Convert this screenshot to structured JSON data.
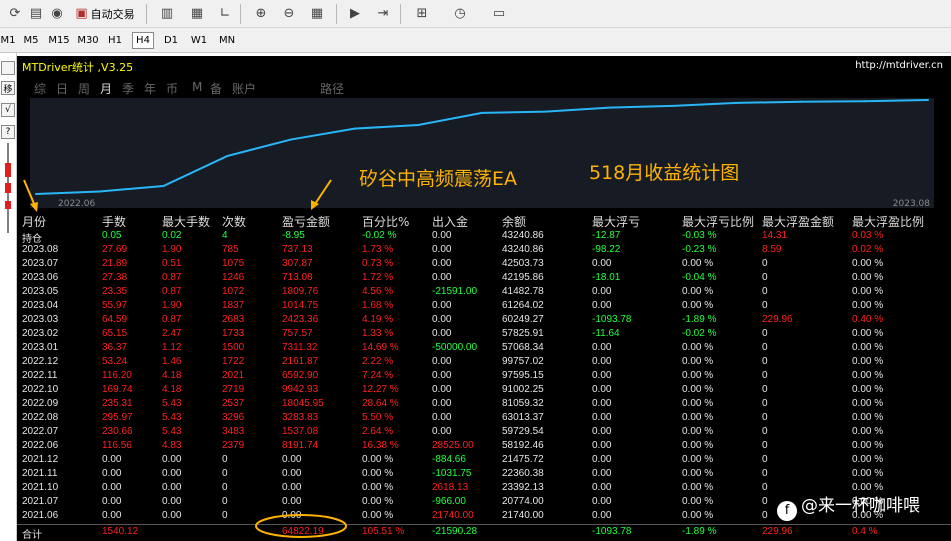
{
  "toolbar": {
    "auto_trade_label": "自动交易",
    "icons": [
      "refresh-icon",
      "chart-icon",
      "signal-icon",
      "auto-trade-icon",
      "bar-chart-icon",
      "candlestick-icon",
      "line-chart-icon",
      "zoom-in-icon",
      "zoom-out-icon",
      "tile-windows-icon",
      "chart-shift-icon",
      "autoscroll-icon",
      "indicators-icon",
      "periods-icon",
      "templates-icon"
    ]
  },
  "timeframes": [
    "M1",
    "M5",
    "M15",
    "M30",
    "H1",
    "H4",
    "D1",
    "W1",
    "MN"
  ],
  "timeframe_selected": "H4",
  "left_strip": [
    "移",
    "√",
    "?"
  ],
  "panel": {
    "title": "MTDriver统计 ,V3.25",
    "url": "http://mtdriver.cn",
    "tabs": [
      "综",
      "日",
      "周",
      "月",
      "季",
      "年",
      "币",
      "M",
      "备",
      "账户",
      "路径"
    ],
    "selected_tab": "月",
    "chart_start": "2022.06",
    "chart_end": "2023.08",
    "annotation_left": "矽谷中高频震荡EA",
    "annotation_right": "518月收益统计图"
  },
  "chart_data": {
    "type": "line",
    "x": [
      "2022.06",
      "2022.07",
      "2022.08",
      "2022.09",
      "2022.10",
      "2022.11",
      "2022.12",
      "2023.01",
      "2023.02",
      "2023.03",
      "2023.04",
      "2023.05",
      "2023.06",
      "2023.07",
      "2023.08"
    ],
    "values": [
      8191.74,
      9728.8,
      13012.63,
      31058.58,
      41001.51,
      47594.41,
      49756.28,
      57067.6,
      57825.17,
      60248.53,
      61263.28,
      63073.04,
      63786.12,
      64093.99,
      64831.12
    ],
    "color": "#29b6f6",
    "grid": false
  },
  "table": {
    "headers": [
      "月份",
      "手数",
      "最大手数",
      "次数",
      "盈亏金额",
      "百分比%",
      "出入金",
      "余额",
      "最大浮亏",
      "最大浮亏比例",
      "最大浮盈金额",
      "最大浮盈比例"
    ],
    "rows": [
      {
        "c": [
          "持仓",
          "0.05",
          "0.02",
          "4",
          "-8.95",
          "-0.02 %",
          "0.00",
          "43240.86",
          "-12.87",
          "-0.03 %",
          "14.31",
          "0.03 %"
        ],
        "k": [
          "w",
          "g",
          "g",
          "g",
          "g",
          "g",
          "w",
          "w",
          "g",
          "g",
          "r",
          "r"
        ]
      },
      {
        "c": [
          "2023.08",
          "27.69",
          "1.90",
          "785",
          "737.13",
          "1.73 %",
          "0.00",
          "43240.86",
          "-98.22",
          "-0.23 %",
          "8.59",
          "0.02 %"
        ],
        "k": [
          "w",
          "r",
          "r",
          "r",
          "r",
          "r",
          "w",
          "w",
          "g",
          "g",
          "r",
          "r"
        ]
      },
      {
        "c": [
          "2023.07",
          "21.89",
          "0.51",
          "1075",
          "307.87",
          "0.73 %",
          "0.00",
          "42503.73",
          "0.00",
          "0.00 %",
          "0",
          "0.00 %"
        ],
        "k": [
          "w",
          "r",
          "r",
          "r",
          "r",
          "r",
          "w",
          "w",
          "w",
          "w",
          "w",
          "w"
        ]
      },
      {
        "c": [
          "2023.06",
          "27.38",
          "0.87",
          "1246",
          "713.08",
          "1.72 %",
          "0.00",
          "42195.86",
          "-18.01",
          "-0.04 %",
          "0",
          "0.00 %"
        ],
        "k": [
          "w",
          "r",
          "r",
          "r",
          "r",
          "r",
          "w",
          "w",
          "g",
          "g",
          "w",
          "w"
        ]
      },
      {
        "c": [
          "2023.05",
          "23.35",
          "0.87",
          "1072",
          "1809.76",
          "4.56 %",
          "-21591.00",
          "41482.78",
          "0.00",
          "0.00 %",
          "0",
          "0.00 %"
        ],
        "k": [
          "w",
          "r",
          "r",
          "r",
          "r",
          "r",
          "g",
          "w",
          "w",
          "w",
          "w",
          "w"
        ]
      },
      {
        "c": [
          "2023.04",
          "55.97",
          "1.90",
          "1837",
          "1014.75",
          "1.68 %",
          "0.00",
          "61264.02",
          "0.00",
          "0.00 %",
          "0",
          "0.00 %"
        ],
        "k": [
          "w",
          "r",
          "r",
          "r",
          "r",
          "r",
          "w",
          "w",
          "w",
          "w",
          "w",
          "w"
        ]
      },
      {
        "c": [
          "2023.03",
          "64.59",
          "0.87",
          "2683",
          "2423.36",
          "4.19 %",
          "0.00",
          "60249.27",
          "-1093.78",
          "-1.89 %",
          "229.96",
          "0.40 %"
        ],
        "k": [
          "w",
          "r",
          "r",
          "r",
          "r",
          "r",
          "w",
          "w",
          "g",
          "g",
          "r",
          "r"
        ]
      },
      {
        "c": [
          "2023.02",
          "65.15",
          "2.47",
          "1733",
          "757.57",
          "1.33 %",
          "0.00",
          "57825.91",
          "-11.64",
          "-0.02 %",
          "0",
          "0.00 %"
        ],
        "k": [
          "w",
          "r",
          "r",
          "r",
          "r",
          "r",
          "w",
          "w",
          "g",
          "g",
          "w",
          "w"
        ]
      },
      {
        "c": [
          "2023.01",
          "36.37",
          "1.12",
          "1500",
          "7311.32",
          "14.69 %",
          "-50000.00",
          "57068.34",
          "0.00",
          "0.00 %",
          "0",
          "0.00 %"
        ],
        "k": [
          "w",
          "r",
          "r",
          "r",
          "r",
          "r",
          "g",
          "w",
          "w",
          "w",
          "w",
          "w"
        ]
      },
      {
        "c": [
          "2022.12",
          "53.24",
          "1.46",
          "1722",
          "2161.87",
          "2.22 %",
          "0.00",
          "99757.02",
          "0.00",
          "0.00 %",
          "0",
          "0.00 %"
        ],
        "k": [
          "w",
          "r",
          "r",
          "r",
          "r",
          "r",
          "w",
          "w",
          "w",
          "w",
          "w",
          "w"
        ]
      },
      {
        "c": [
          "2022.11",
          "116.20",
          "4.18",
          "2021",
          "6592.90",
          "7.24 %",
          "0.00",
          "97595.15",
          "0.00",
          "0.00 %",
          "0",
          "0.00 %"
        ],
        "k": [
          "w",
          "r",
          "r",
          "r",
          "r",
          "r",
          "w",
          "w",
          "w",
          "w",
          "w",
          "w"
        ]
      },
      {
        "c": [
          "2022.10",
          "169.74",
          "4.18",
          "2719",
          "9942.93",
          "12.27 %",
          "0.00",
          "91002.25",
          "0.00",
          "0.00 %",
          "0",
          "0.00 %"
        ],
        "k": [
          "w",
          "r",
          "r",
          "r",
          "r",
          "r",
          "w",
          "w",
          "w",
          "w",
          "w",
          "w"
        ]
      },
      {
        "c": [
          "2022.09",
          "235.31",
          "5.43",
          "2537",
          "18045.95",
          "28.64 %",
          "0.00",
          "81059.32",
          "0.00",
          "0.00 %",
          "0",
          "0.00 %"
        ],
        "k": [
          "w",
          "r",
          "r",
          "r",
          "r",
          "r",
          "w",
          "w",
          "w",
          "w",
          "w",
          "w"
        ]
      },
      {
        "c": [
          "2022.08",
          "295.97",
          "5.43",
          "3296",
          "3283.83",
          "5.50 %",
          "0.00",
          "63013.37",
          "0.00",
          "0.00 %",
          "0",
          "0.00 %"
        ],
        "k": [
          "w",
          "r",
          "r",
          "r",
          "r",
          "r",
          "w",
          "w",
          "w",
          "w",
          "w",
          "w"
        ]
      },
      {
        "c": [
          "2022.07",
          "230.66",
          "5.43",
          "3483",
          "1537.08",
          "2.64 %",
          "0.00",
          "59729.54",
          "0.00",
          "0.00 %",
          "0",
          "0.00 %"
        ],
        "k": [
          "w",
          "r",
          "r",
          "r",
          "r",
          "r",
          "w",
          "w",
          "w",
          "w",
          "w",
          "w"
        ]
      },
      {
        "c": [
          "2022.06",
          "116.56",
          "4.83",
          "2379",
          "8191.74",
          "16.38 %",
          "28525.00",
          "58192.46",
          "0.00",
          "0.00 %",
          "0",
          "0.00 %"
        ],
        "k": [
          "w",
          "r",
          "r",
          "r",
          "r",
          "r",
          "r",
          "w",
          "w",
          "w",
          "w",
          "w"
        ]
      },
      {
        "c": [
          "2021.12",
          "0.00",
          "0.00",
          "0",
          "0.00",
          "0.00 %",
          "-884.66",
          "21475.72",
          "0.00",
          "0.00 %",
          "0",
          "0.00 %"
        ],
        "k": [
          "w",
          "w",
          "w",
          "w",
          "w",
          "w",
          "g",
          "w",
          "w",
          "w",
          "w",
          "w"
        ]
      },
      {
        "c": [
          "2021.11",
          "0.00",
          "0.00",
          "0",
          "0.00",
          "0.00 %",
          "-1031.75",
          "22360.38",
          "0.00",
          "0.00 %",
          "0",
          "0.00 %"
        ],
        "k": [
          "w",
          "w",
          "w",
          "w",
          "w",
          "w",
          "g",
          "w",
          "w",
          "w",
          "w",
          "w"
        ]
      },
      {
        "c": [
          "2021.10",
          "0.00",
          "0.00",
          "0",
          "0.00",
          "0.00 %",
          "2618.13",
          "23392.13",
          "0.00",
          "0.00 %",
          "0",
          "0.00 %"
        ],
        "k": [
          "w",
          "w",
          "w",
          "w",
          "w",
          "w",
          "r",
          "w",
          "w",
          "w",
          "w",
          "w"
        ]
      },
      {
        "c": [
          "2021.07",
          "0.00",
          "0.00",
          "0",
          "0.00",
          "0.00 %",
          "-966.00",
          "20774.00",
          "0.00",
          "0.00 %",
          "0",
          "0.00 %"
        ],
        "k": [
          "w",
          "w",
          "w",
          "w",
          "w",
          "w",
          "g",
          "w",
          "w",
          "w",
          "w",
          "w"
        ]
      },
      {
        "c": [
          "2021.06",
          "0.00",
          "0.00",
          "0",
          "0.00",
          "0.00 %",
          "21740.00",
          "21740.00",
          "0.00",
          "0.00 %",
          "0",
          "0.00 %"
        ],
        "k": [
          "w",
          "w",
          "w",
          "w",
          "w",
          "w",
          "r",
          "w",
          "w",
          "w",
          "w",
          "w"
        ]
      },
      {
        "c": [
          "合计",
          "1540.12",
          "",
          "",
          "64822.19",
          "105.51 %",
          "-21590.28",
          "",
          "-1093.78",
          "-1.89 %",
          "229.96",
          "0.4 %"
        ],
        "k": [
          "w",
          "r",
          "r",
          "r",
          "r",
          "r",
          "g",
          "w",
          "g",
          "g",
          "r",
          "r"
        ]
      }
    ]
  },
  "watermark": "@来一杯咖啡喂"
}
